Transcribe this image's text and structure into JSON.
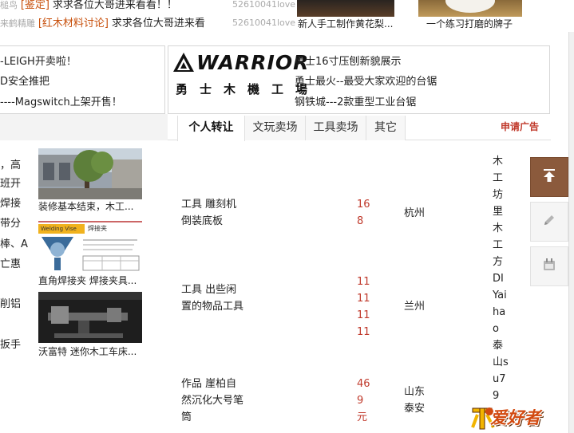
{
  "top_posts": [
    {
      "author": "槌鸟",
      "tag": "[鉴定]",
      "title": "求求各位大哥进来看看！！",
      "uid": "52610041love"
    },
    {
      "author": "来鹤精雕",
      "tag": "[红木材料讨论]",
      "title": "求求各位大哥进来看",
      "uid": "52610041love"
    }
  ],
  "top_thumbs": [
    {
      "caption": "新人手工制作黄花梨..."
    },
    {
      "caption": "一个练习打磨的牌子"
    }
  ],
  "left_ads": [
    "-LEIGH开卖啦！",
    "D安全推把",
    "----Magswitch上架开售！"
  ],
  "warrior": {
    "logo_word": "WARRIOR",
    "logo_cn": "勇士木機工場",
    "lines": [
      "勇士16寸压刨新貌展示",
      "勇士最火--最受大家欢迎的台锯",
      "钢铁城---2款重型工业台锯"
    ]
  },
  "tabs": [
    "个人转让",
    "文玩卖场",
    "工具卖场",
    "其它"
  ],
  "apply_ad": "申请广告",
  "left_snippets": [
    "，高",
    "班开",
    "焊接",
    "带分",
    "棒、A",
    "亡惠",
    "削铝",
    "扳手"
  ],
  "image_posts": [
    {
      "caption": "装修基本结束，木工..."
    },
    {
      "caption": "直角焊接夹  焊接夹具...",
      "banner_left": "Welding Vise",
      "banner_right": "焊接夹"
    },
    {
      "caption": "沃富特  迷你木工车床..."
    }
  ],
  "listings": [
    {
      "title": "工具   雕刻机倒装底板",
      "price": "168",
      "city": "杭州"
    },
    {
      "title": "工具   出些闲置的物品工具",
      "price": "11111111",
      "city": "兰州"
    },
    {
      "title": "作品   崖柏自然沉化大号笔筒",
      "price": "469元",
      "city": "山东泰安"
    }
  ],
  "seller_text": "木工坊里木工方DIYaihao泰山su79",
  "watermark": "爱好者",
  "colors": {
    "accent": "#c0392b",
    "tag": "#c8500c",
    "tool_top": "#8b5a3c"
  }
}
